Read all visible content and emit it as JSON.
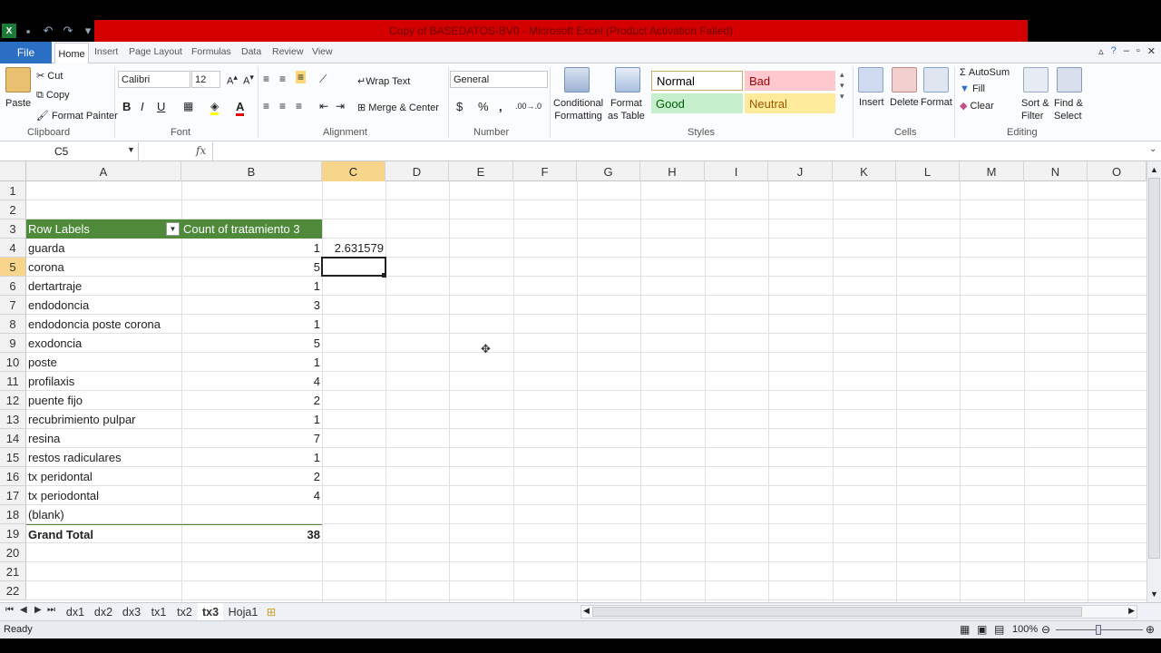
{
  "window": {
    "title": "Copy of BASEDATOS-BV0 - Microsoft Excel (Product Activation Failed)"
  },
  "ribbon_tabs": {
    "file": "File",
    "items": [
      "Home",
      "Insert",
      "Page Layout",
      "Formulas",
      "Data",
      "Review",
      "View"
    ]
  },
  "clipboard": {
    "paste": "Paste",
    "cut": "Cut",
    "copy": "Copy",
    "format_painter": "Format Painter",
    "group_label": "Clipboard"
  },
  "font": {
    "name": "Calibri",
    "size": "12",
    "bold": "B",
    "italic": "I",
    "underline": "U",
    "group_label": "Font"
  },
  "alignment": {
    "wrap_text": "Wrap Text",
    "merge_center": "Merge & Center",
    "group_label": "Alignment"
  },
  "number": {
    "format": "General",
    "currency": "$",
    "percent": "%",
    "comma": ",",
    "group_label": "Number"
  },
  "styles": {
    "conditional_formatting": [
      "Conditional",
      "Formatting"
    ],
    "format_as_table": [
      "Format",
      "as Table"
    ],
    "normal": "Normal",
    "bad": "Bad",
    "good": "Good",
    "neutral": "Neutral",
    "group_label": "Styles",
    "colors": {
      "bad_bg": "#ffc7ce",
      "good_bg": "#c6efce",
      "neutral_bg": "#ffeb9c",
      "bad_fg": "#9c0006",
      "good_fg": "#006100",
      "neutral_fg": "#9c5700"
    }
  },
  "cells_group": {
    "insert": "Insert",
    "delete": "Delete",
    "format": "Format",
    "group_label": "Cells"
  },
  "editing": {
    "autosum": "AutoSum",
    "fill": "Fill",
    "clear": "Clear",
    "sort_filter": [
      "Sort &",
      "Filter"
    ],
    "find_select": [
      "Find &",
      "Select"
    ],
    "group_label": "Editing"
  },
  "formula_bar": {
    "name_box": "C5",
    "fx": "fx",
    "formula": ""
  },
  "columns": [
    "A",
    "B",
    "C",
    "D",
    "E",
    "F",
    "G",
    "H",
    "I",
    "J",
    "K",
    "L",
    "M",
    "N",
    "O"
  ],
  "rows": [
    "1",
    "2",
    "3",
    "4",
    "5",
    "6",
    "7",
    "8",
    "9",
    "10",
    "11",
    "12",
    "13",
    "14",
    "15",
    "16",
    "17",
    "18",
    "19",
    "20",
    "21",
    "22"
  ],
  "pivot": {
    "header_row_labels": "Row Labels",
    "header_count": "Count of tratamiento 3",
    "rows": [
      {
        "label": "guarda",
        "count": "1"
      },
      {
        "label": "corona",
        "count": "5"
      },
      {
        "label": "dertartraje",
        "count": "1"
      },
      {
        "label": "endodoncia",
        "count": "3"
      },
      {
        "label": "endodoncia poste corona",
        "count": "1"
      },
      {
        "label": "exodoncia",
        "count": "5"
      },
      {
        "label": "poste",
        "count": "1"
      },
      {
        "label": "profilaxis",
        "count": "4"
      },
      {
        "label": "puente fijo",
        "count": "2"
      },
      {
        "label": "recubrimiento pulpar",
        "count": "1"
      },
      {
        "label": "resina",
        "count": "7"
      },
      {
        "label": "restos radiculares",
        "count": "1"
      },
      {
        "label": "tx peridontal",
        "count": "2"
      },
      {
        "label": "tx periodontal",
        "count": "4"
      },
      {
        "label": "(blank)",
        "count": ""
      }
    ],
    "grand_total_label": "Grand Total",
    "grand_total": "38",
    "header_color": "#4e8a3a"
  },
  "cell_c4": "2.631579",
  "sheets": [
    "dx1",
    "dx2",
    "dx3",
    "tx1",
    "tx2",
    "tx3",
    "Hoja1"
  ],
  "active_sheet": "tx3",
  "status": {
    "mode": "Ready",
    "zoom": "100%"
  }
}
